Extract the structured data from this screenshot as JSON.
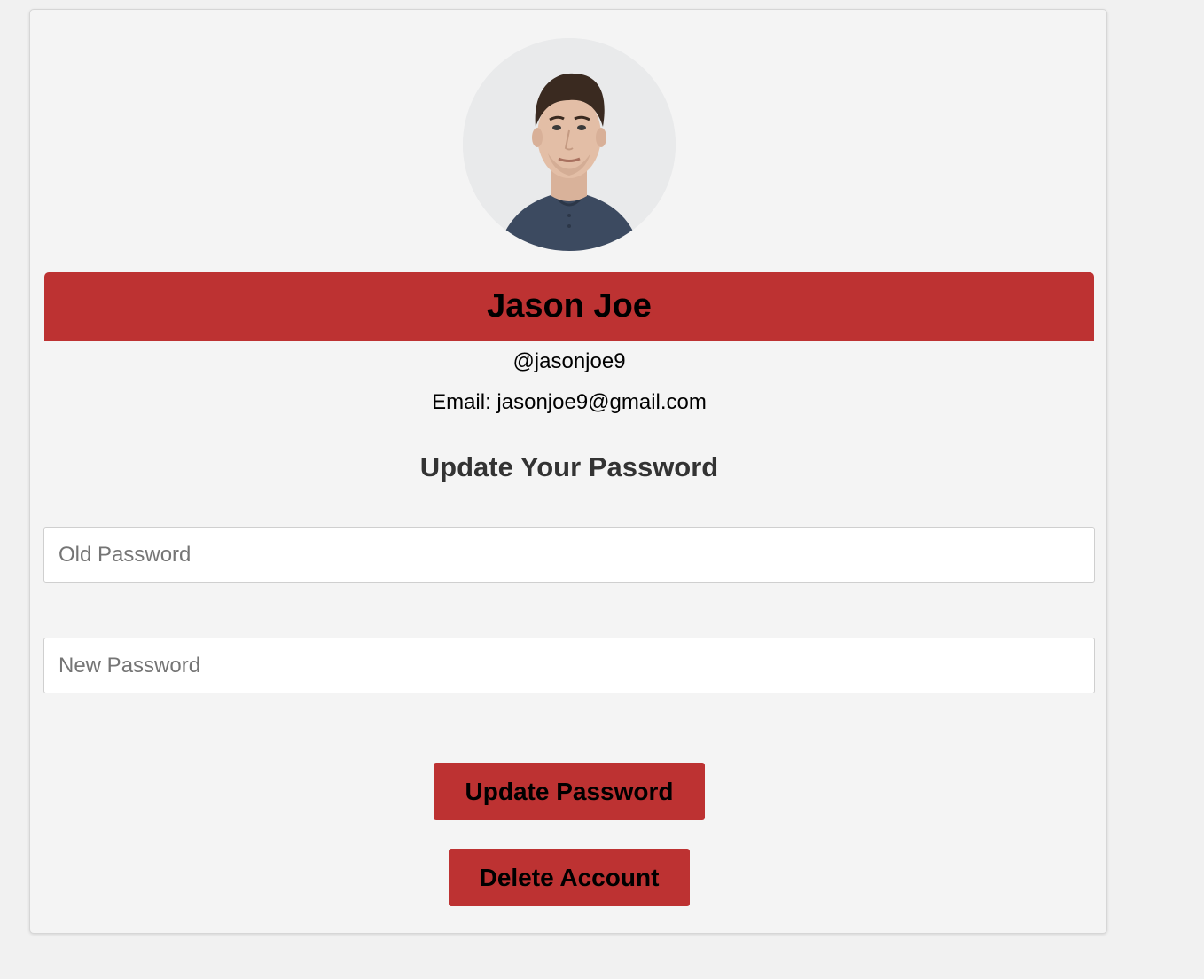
{
  "profile": {
    "name": "Jason Joe",
    "username": "@jasonjoe9",
    "email_line": "Email: jasonjoe9@gmail.com"
  },
  "password_form": {
    "title": "Update Your Password",
    "old_placeholder": "Old Password",
    "new_placeholder": "New Password",
    "update_label": "Update Password",
    "delete_label": "Delete Account"
  },
  "colors": {
    "accent": "#bd3232",
    "card_bg": "#f4f4f4",
    "page_bg": "#f1f1f1"
  },
  "icons": {
    "avatar": "profile-photo"
  }
}
